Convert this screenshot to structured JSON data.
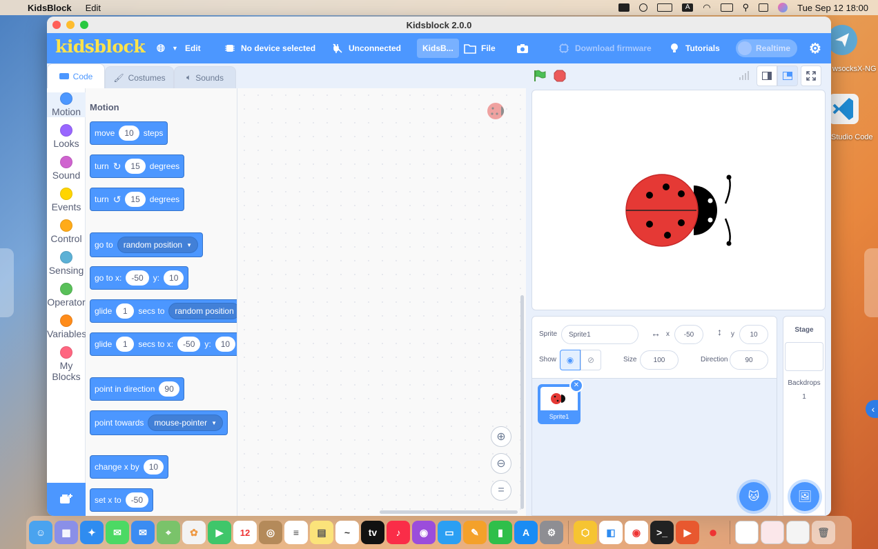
{
  "menubar": {
    "app_name": "KidsBlock",
    "menu_edit": "Edit",
    "clock": "Tue Sep 12  18:00"
  },
  "desktop": {
    "icon1_label": "ShadowsocksX-NG",
    "icon1_label_visible": "wsocksX-NG",
    "icon2_label_visible": "Studio Code"
  },
  "window": {
    "title": "Kidsblock 2.0.0"
  },
  "toolbar": {
    "logo": "kidsblock",
    "edit": "Edit",
    "device": "No device selected",
    "connection": "Unconnected",
    "project_name": "KidsB...",
    "file": "File",
    "download_firmware": "Download firmware",
    "tutorials": "Tutorials",
    "realtime": "Realtime"
  },
  "tabs": {
    "code": "Code",
    "costumes": "Costumes",
    "sounds": "Sounds"
  },
  "categories": [
    {
      "label": "Motion",
      "color": "#4c97ff"
    },
    {
      "label": "Looks",
      "color": "#9966ff"
    },
    {
      "label": "Sound",
      "color": "#cf63cf"
    },
    {
      "label": "Events",
      "color": "#ffd500"
    },
    {
      "label": "Control",
      "color": "#ffab19"
    },
    {
      "label": "Sensing",
      "color": "#5cb1d6"
    },
    {
      "label": "Operator",
      "color": "#59c059"
    },
    {
      "label": "Variables",
      "color": "#ff8c1a"
    },
    {
      "label": "My Blocks",
      "color": "#ff6680"
    }
  ],
  "palette": {
    "title": "Motion",
    "move": {
      "a": "move",
      "v": "10",
      "b": "steps"
    },
    "turn_cw": {
      "a": "turn",
      "v": "15",
      "b": "degrees"
    },
    "turn_ccw": {
      "a": "turn",
      "v": "15",
      "b": "degrees"
    },
    "goto": {
      "a": "go to",
      "dd": "random position"
    },
    "gotoxy": {
      "a": "go to x:",
      "x": "-50",
      "b": "y:",
      "y": "10"
    },
    "glide": {
      "a": "glide",
      "v": "1",
      "b": "secs to",
      "dd": "random position"
    },
    "glidexy": {
      "a": "glide",
      "v": "1",
      "b": "secs to x:",
      "x": "-50",
      "c": "y:",
      "y": "10"
    },
    "point_dir": {
      "a": "point in direction",
      "v": "90"
    },
    "point_towards": {
      "a": "point towards",
      "dd": "mouse-pointer"
    },
    "change_x": {
      "a": "change x by",
      "v": "10"
    },
    "set_x": {
      "a": "set x to",
      "v": "-50"
    }
  },
  "sprite_info": {
    "sprite_label": "Sprite",
    "sprite_name": "Sprite1",
    "x_label": "x",
    "x": "-50",
    "y_label": "y",
    "y": "10",
    "show_label": "Show",
    "size_label": "Size",
    "size": "100",
    "direction_label": "Direction",
    "direction": "90"
  },
  "sprites": [
    {
      "name": "Sprite1"
    }
  ],
  "stage_panel": {
    "title": "Stage",
    "backdrops_label": "Backdrops",
    "backdrops_count": "1"
  },
  "colors": {
    "accent": "#4c97ff",
    "toolbar": "#4c97ff",
    "logo": "#ffe34a"
  }
}
